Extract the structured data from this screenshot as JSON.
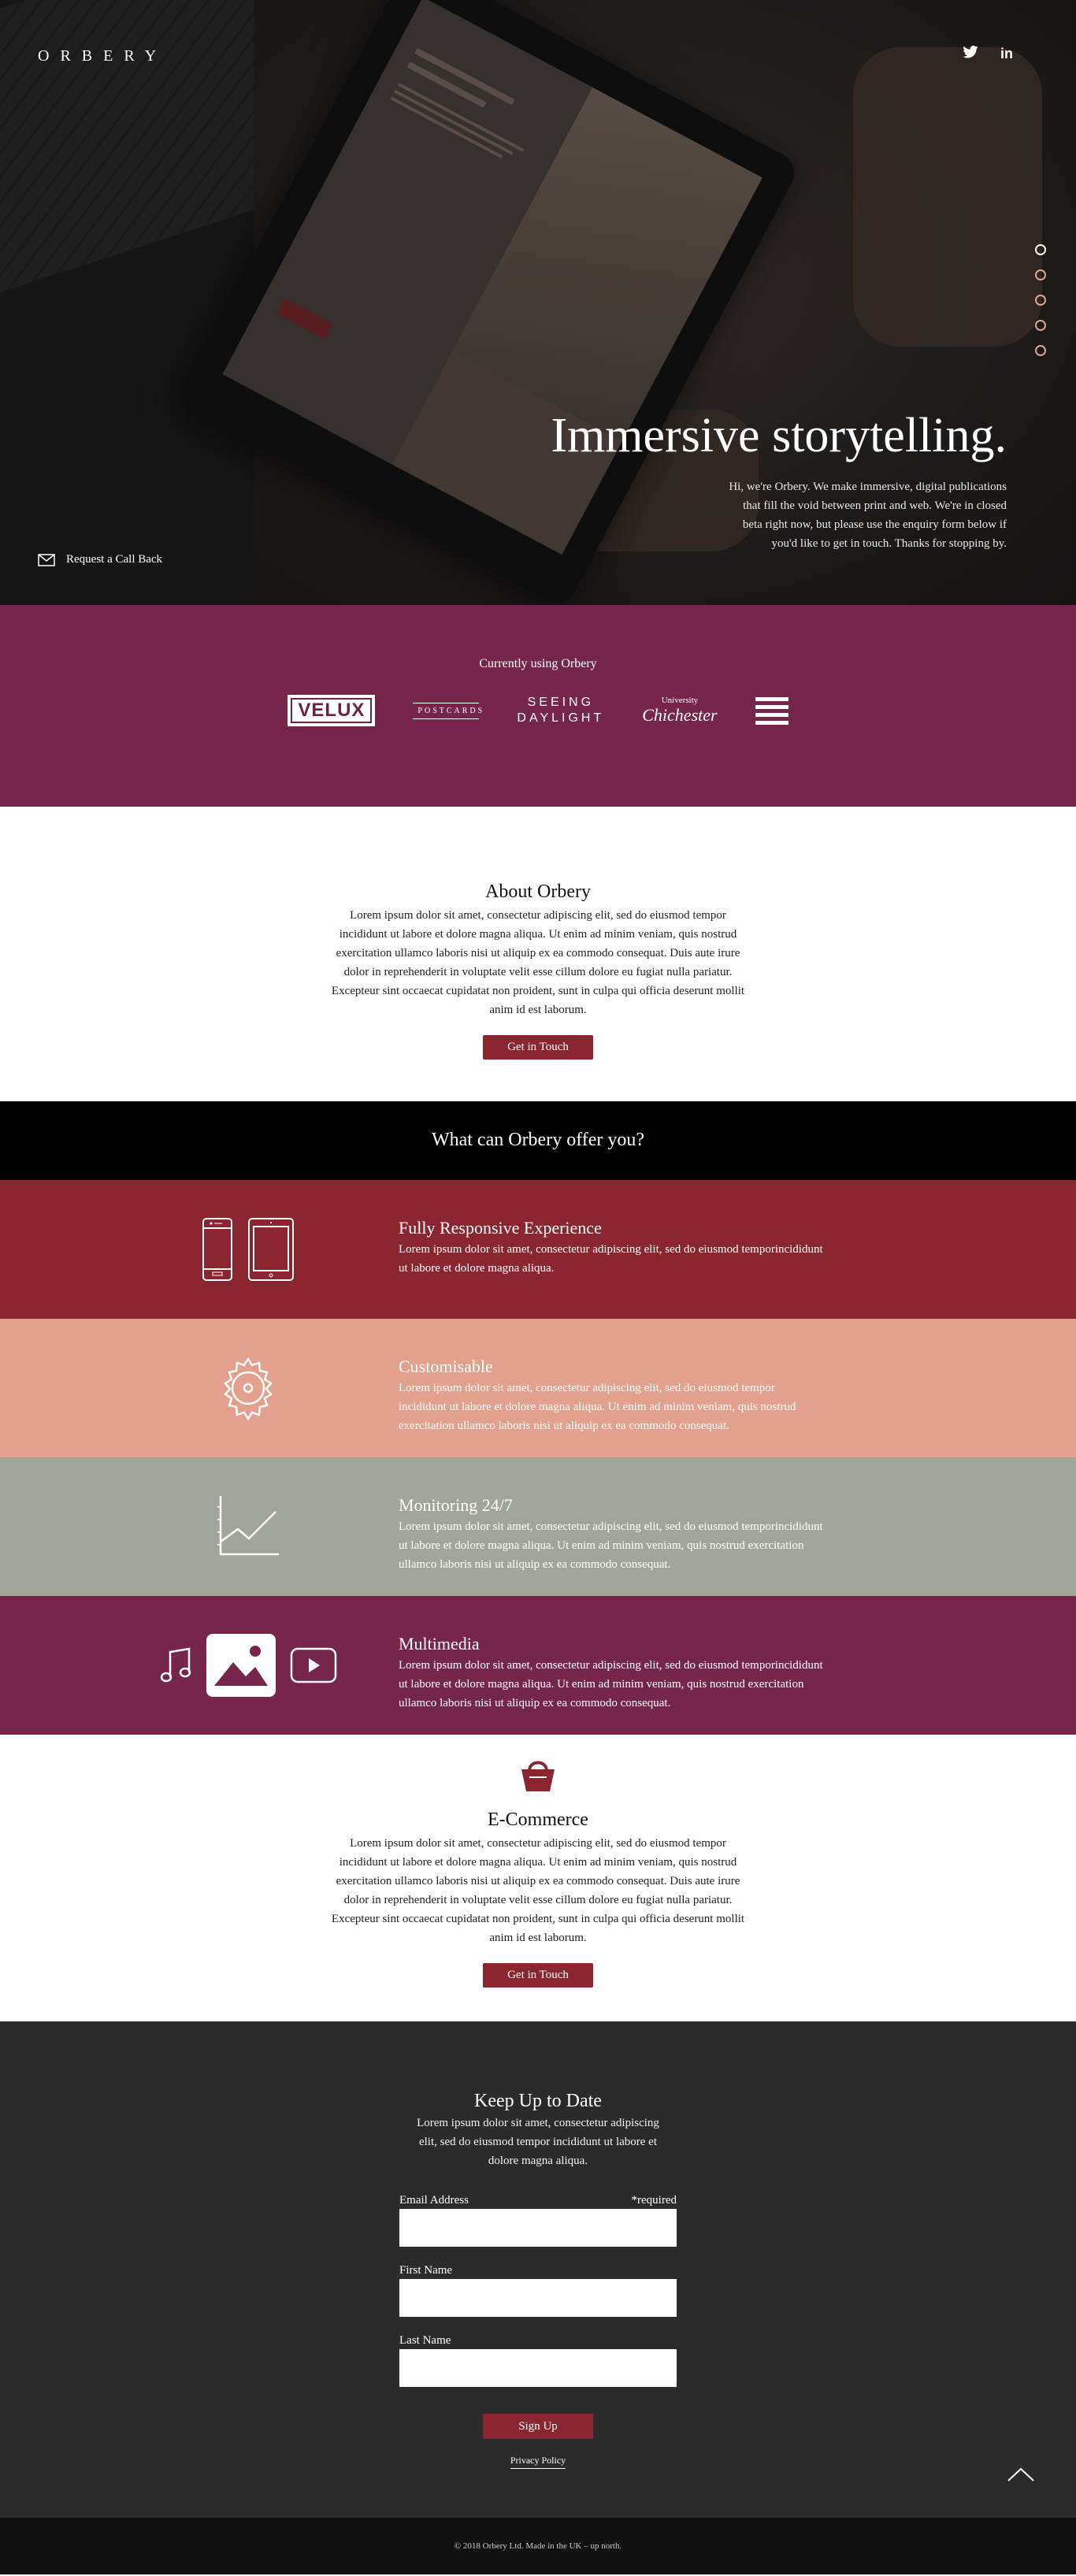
{
  "brand": {
    "logo": "ORBERY"
  },
  "social": {
    "twitter_icon": "twitter-icon",
    "linkedin": "in"
  },
  "hero": {
    "title": "Immersive storytelling.",
    "text": "Hi, we're Orbery. We make immersive, digital publications that fill the void between print and web. We're in closed beta right now, but please use the enquiry form below if you'd like to get in touch. Thanks for stopping by.",
    "callback": "Request a Call Back",
    "slides": 5,
    "active_slide": 1
  },
  "clients": {
    "title": "Currently using Orbery",
    "velux": "VELUX",
    "postcards": "POSTCARDS",
    "seeing": "SEEING",
    "daylight": "DAYLIGHT",
    "chichester_small": "University",
    "chichester": "Chichester"
  },
  "about": {
    "title": "About Orbery",
    "text": "Lorem ipsum dolor sit amet, consectetur adipiscing elit, sed do eiusmod tempor incididunt ut labore et dolore magna aliqua. Ut enim ad minim veniam, quis nostrud exercitation ullamco laboris nisi ut aliquip ex ea commodo consequat. Duis aute irure dolor in reprehenderit in voluptate velit esse cillum dolore eu fugiat nulla pariatur. Excepteur sint occaecat cupidatat non proident, sunt in culpa qui officia deserunt mollit anim id est laborum.",
    "button": "Get in Touch"
  },
  "offer": {
    "title": "What can Orbery offer you?"
  },
  "features": [
    {
      "title": "Fully Responsive Experience",
      "text": "Lorem ipsum dolor sit amet, consectetur adipiscing elit, sed do eiusmod temporincididunt ut labore et dolore magna aliqua.",
      "color": "#8b2530"
    },
    {
      "title": "Customisable",
      "text": "Lorem ipsum dolor sit amet, consectetur adipiscing elit, sed do eiusmod tempor incididunt ut labore et dolore magna aliqua. Ut enim ad minim veniam, quis nostrud exercitation ullamco laboris nisi ut aliquip ex ea commodo consequat.",
      "color": "#e3a08c"
    },
    {
      "title": "Monitoring 24/7",
      "text": "Lorem ipsum dolor sit amet, consectetur adipiscing elit, sed do eiusmod temporincididunt ut labore et dolore magna aliqua. Ut enim ad minim veniam, quis nostrud exercitation ullamco laboris nisi ut aliquip ex ea commodo consequat.",
      "color": "#a0a69c"
    },
    {
      "title": "Multimedia",
      "text": "Lorem ipsum dolor sit amet, consectetur adipiscing elit, sed do eiusmod temporincididunt ut labore et dolore magna aliqua. Ut enim ad minim veniam, quis nostrud exercitation ullamco laboris nisi ut aliquip ex ea commodo consequat.",
      "color": "#77264b"
    }
  ],
  "ecommerce": {
    "title": "E-Commerce",
    "text": "Lorem ipsum dolor sit amet, consectetur adipiscing elit, sed do eiusmod tempor incididunt ut labore et dolore magna aliqua. Ut enim ad minim veniam, quis nostrud exercitation ullamco laboris nisi ut aliquip ex ea commodo consequat. Duis aute irure dolor in reprehenderit in voluptate velit esse cillum dolore eu fugiat nulla pariatur. Excepteur sint occaecat cupidatat non proident, sunt in culpa qui officia deserunt mollit anim id est laborum.",
    "button": "Get in Touch"
  },
  "newsletter": {
    "title": "Keep Up to Date",
    "text": "Lorem ipsum dolor sit amet, consectetur adipiscing elit, sed do eiusmod tempor incididunt ut labore et dolore magna aliqua.",
    "email_label": "Email Address",
    "required": "*required",
    "first_name_label": "First Name",
    "last_name_label": "Last Name",
    "button": "Sign Up",
    "privacy": "Privacy Policy"
  },
  "footer": {
    "text": "© 2018 Orbery Ltd. Made in the UK – up north."
  },
  "colors": {
    "accent": "#8b2530",
    "plum": "#77264b",
    "peach": "#e3a08c",
    "sage": "#a0a69c",
    "dark": "#2b2b2b"
  }
}
